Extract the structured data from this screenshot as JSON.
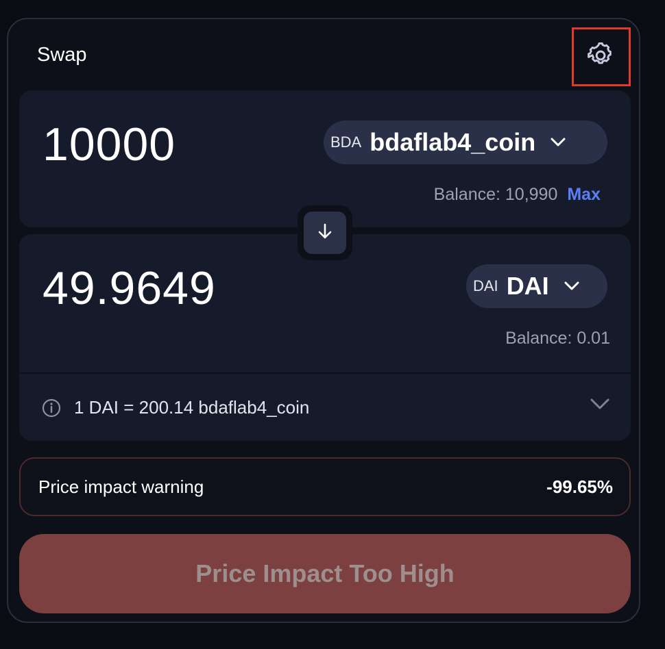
{
  "header": {
    "title": "Swap",
    "settings_icon": "gear-icon",
    "annotation": "click"
  },
  "from": {
    "amount": "10000",
    "token_symbol": "BDA",
    "token_name": "bdaflab4_coin",
    "balance_label": "Balance: 10,990",
    "max_label": "Max"
  },
  "swap_direction_icon": "arrow-down-icon",
  "to": {
    "amount": "49.9649",
    "token_symbol": "DAI",
    "token_name": "DAI",
    "balance_label": "Balance: 0.01"
  },
  "rate": {
    "text": "1 DAI = 200.14 bdaflab4_coin",
    "info_icon": "info-icon"
  },
  "warning": {
    "label": "Price impact warning",
    "value": "-99.65%"
  },
  "action": {
    "label": "Price Impact Too High"
  },
  "colors": {
    "background": "#0a0c13",
    "panel": "#161b2b",
    "accent": "#5b7ef5",
    "danger_button": "#7d4040",
    "annotation": "#e23a2a"
  }
}
